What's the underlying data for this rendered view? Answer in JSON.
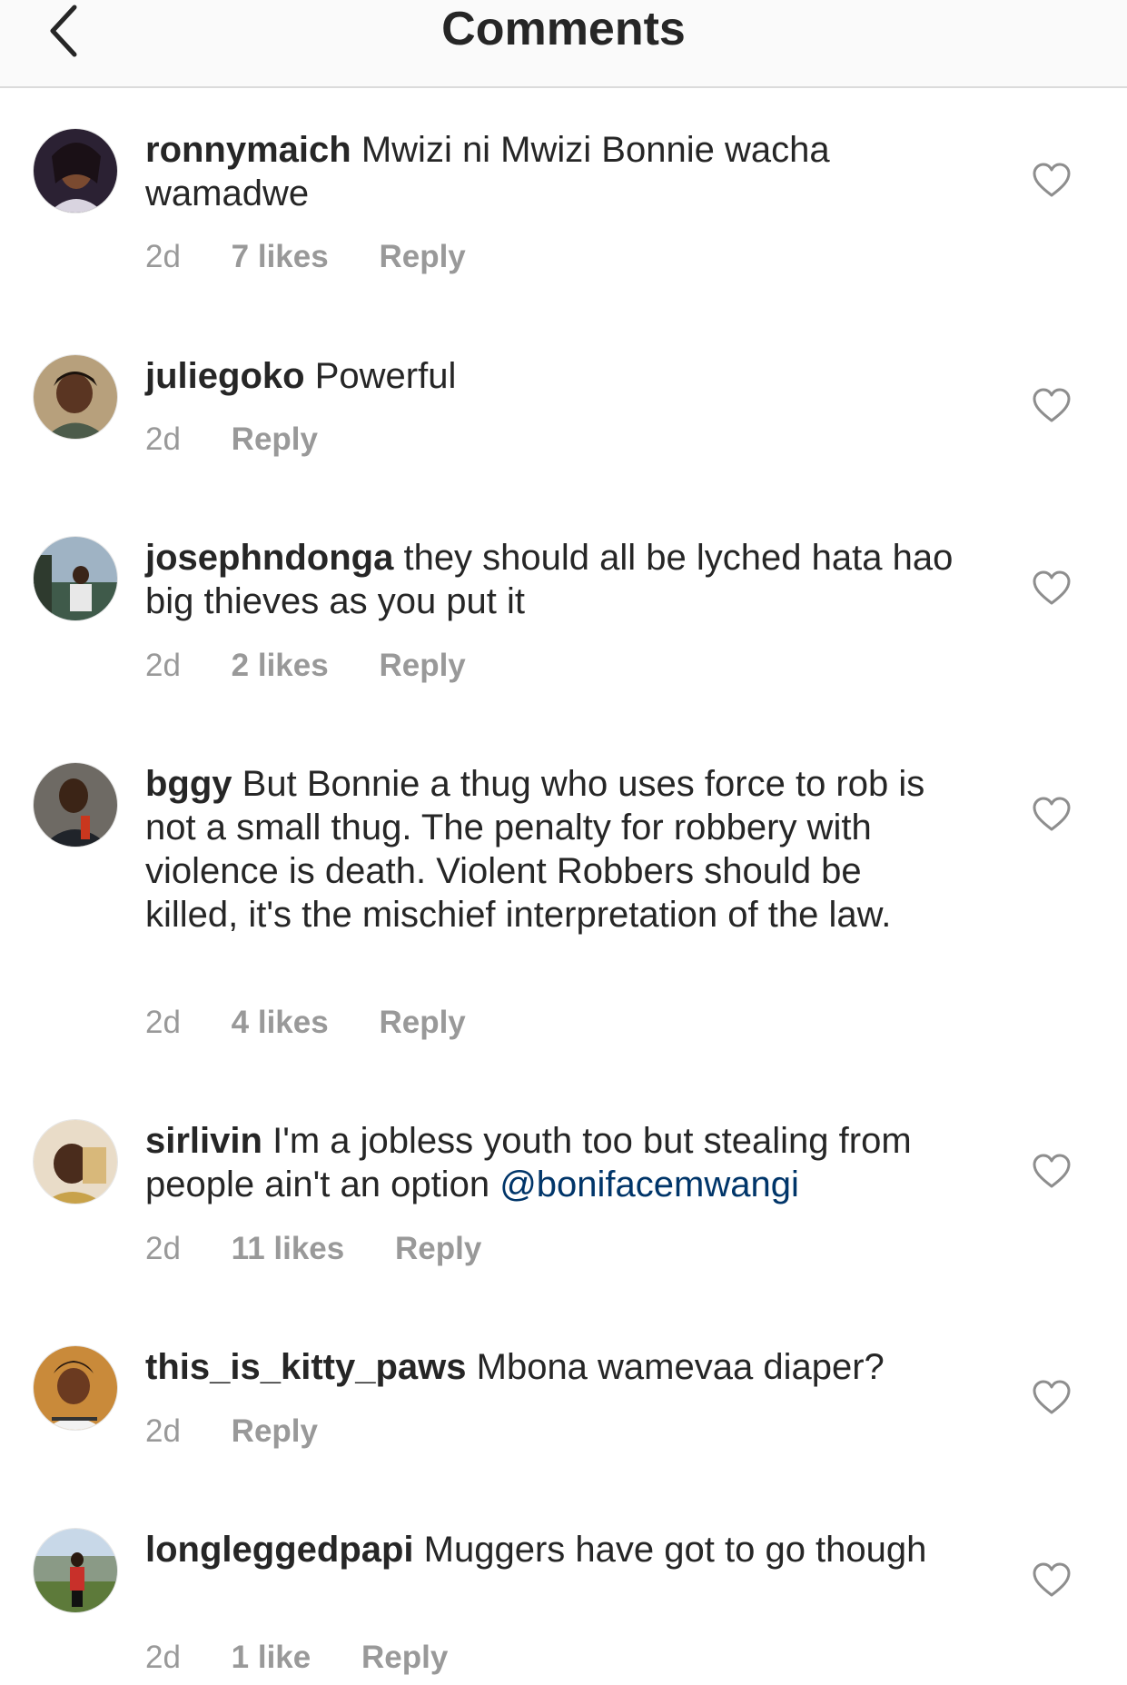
{
  "header": {
    "title": "Comments"
  },
  "colors": {
    "meta": "#999999",
    "mention": "#003569",
    "text": "#262626",
    "header_bg": "#fafafa"
  },
  "comments": [
    {
      "username": "ronnymaich",
      "text": "Mwizi ni Mwizi Bonnie wacha wamadwe",
      "time": "2d",
      "likes": "7 likes",
      "reply": "Reply"
    },
    {
      "username": "juliegoko",
      "text": "Powerful",
      "time": "2d",
      "reply": "Reply"
    },
    {
      "username": "josephndonga",
      "text": "they should all be lyched hata hao big thieves as you put it",
      "time": "2d",
      "likes": "2 likes",
      "reply": "Reply"
    },
    {
      "username": "bggy",
      "text": "But Bonnie a thug who uses force to rob is not a small thug. The penalty for robbery with violence is death. Violent Robbers should be killed, it's the mischief interpretation of the law.",
      "time": "2d",
      "likes": "4 likes",
      "reply": "Reply"
    },
    {
      "username": "sirlivin",
      "text": "I'm a jobless youth too but stealing from people ain't an option",
      "mention": "@bonifacemwangi",
      "time": "2d",
      "likes": "11 likes",
      "reply": "Reply"
    },
    {
      "username": "this_is_kitty_paws",
      "text": "Mbona wamevaa diaper?",
      "time": "2d",
      "reply": "Reply"
    },
    {
      "username": "longleggedpapi",
      "text": "Muggers have got to go though",
      "time": "2d",
      "likes": "1 like",
      "reply": "Reply"
    }
  ]
}
